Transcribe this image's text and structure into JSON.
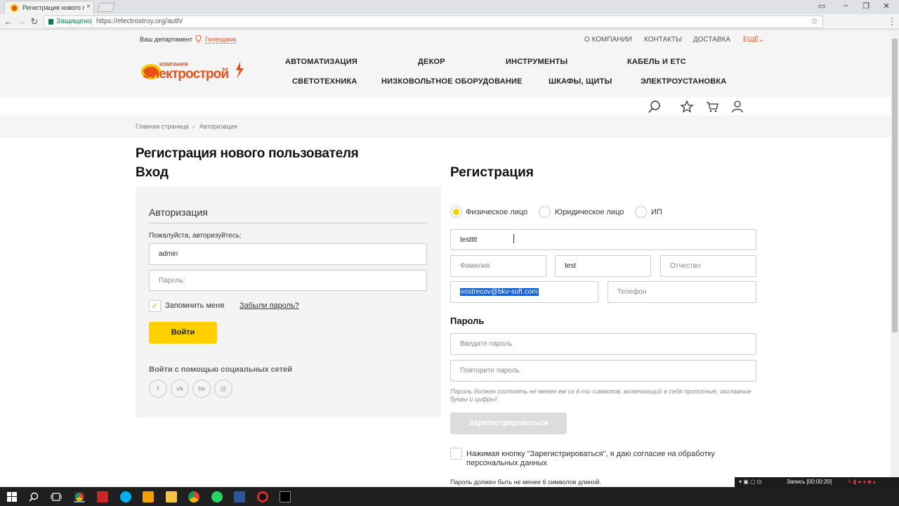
{
  "browser": {
    "tab_title": "Регистрация нового по...",
    "tab_close": "×",
    "security_label": "Защищено",
    "url": "https://electrostroy.org/auth/"
  },
  "header": {
    "department_label": "Ваш департамент",
    "city": "Геленджик",
    "top_links": [
      "О КОМПАНИИ",
      "КОНТАКТЫ",
      "ДОСТАВКА",
      "ЕЩЁ"
    ],
    "logo_small": "КОМПАНИЯ",
    "logo_main": "Электрострой",
    "categories_row1": [
      "АВТОМАТИЗАЦИЯ",
      "ДЕКОР",
      "ИНСТРУМЕНТЫ",
      "КАБЕЛЬ И ЕТС"
    ],
    "categories_row2": [
      "СВЕТОТЕХНИКА",
      "НИЗКОВОЛЬТНОЕ ОБОРУДОВАНИЕ",
      "ШКАФЫ, ЩИТЫ",
      "ЭЛЕКТРОУСТАНОВКА"
    ]
  },
  "breadcrumb": {
    "items": [
      "Главная страница",
      "Авторизация"
    ],
    "separator": "›"
  },
  "page": {
    "title_line1": "Регистрация нового пользователя",
    "title_line2": "Вход"
  },
  "auth": {
    "title": "Авторизация",
    "hint": "Пожалуйста, авторизуйтесь:",
    "login_value": "admin",
    "password_placeholder": "Пароль:",
    "remember_label": "Запомнить меня",
    "remember_checked": true,
    "forgot_link": "Забыли пароль?",
    "login_button": "Войти",
    "social_label": "Войти с помощью социальных сетей",
    "social_icons": [
      "f",
      "vk",
      "tw",
      "@"
    ]
  },
  "registration": {
    "title": "Регистрация",
    "types": [
      {
        "label": "Физическое лицо",
        "selected": true
      },
      {
        "label": "Юридическое лицо",
        "selected": false
      },
      {
        "label": "ИП",
        "selected": false
      }
    ],
    "first_field_value": "testttt",
    "lastname_placeholder": "Фамилия",
    "name_value": "test",
    "patronymic_placeholder": "Отчество",
    "email_value": "vostrecov@bkv-soft.com",
    "phone_placeholder": "Телефон",
    "password_section": "Пароль",
    "password_placeholder": "Введите пароль",
    "password_repeat_placeholder": "Повторите пароль",
    "password_note": "Пароль должен состоять не менее ем из 6-ти символов, включающий в себя прописные, заглавные буквы и цифры!",
    "register_button": "Зарегистрироваться",
    "agree_text": "Нажимая кнопку \"Зарегистрироваться\", я даю согласие на обработку персональных данных",
    "min_length_note": "Пароль должен быть не менее 6 символов длиной."
  },
  "recorder": {
    "status": "Запись [00:00:20]"
  },
  "colors": {
    "accent_yellow": "#ffd000",
    "brand_orange": "#e8501a",
    "selection_blue": "#1a5fd1"
  }
}
